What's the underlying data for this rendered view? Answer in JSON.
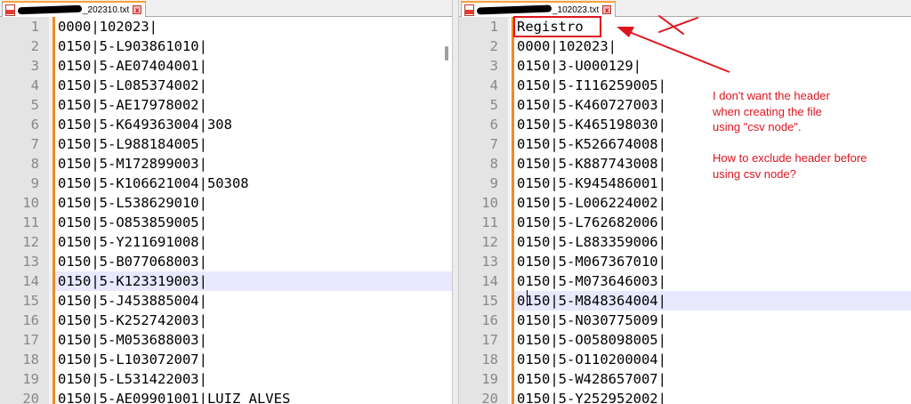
{
  "left_pane": {
    "tab": {
      "label": "_202310.txt",
      "close_glyph": "x"
    },
    "lines": [
      {
        "n": "1",
        "text": "0000|102023|"
      },
      {
        "n": "2",
        "text": "0150|5-L903861010|"
      },
      {
        "n": "3",
        "text": "0150|5-AE07404001|"
      },
      {
        "n": "4",
        "text": "0150|5-L085374002|"
      },
      {
        "n": "5",
        "text": "0150|5-AE17978002|"
      },
      {
        "n": "6",
        "text": "0150|5-K649363004|308"
      },
      {
        "n": "7",
        "text": "0150|5-L988184005|"
      },
      {
        "n": "8",
        "text": "0150|5-M172899003|"
      },
      {
        "n": "9",
        "text": "0150|5-K106621004|50308"
      },
      {
        "n": "10",
        "text": "0150|5-L538629010|"
      },
      {
        "n": "11",
        "text": "0150|5-O853859005|"
      },
      {
        "n": "12",
        "text": "0150|5-Y211691008|"
      },
      {
        "n": "13",
        "text": "0150|5-B077068003|"
      },
      {
        "n": "14",
        "text": "0150|5-K123319003|"
      },
      {
        "n": "15",
        "text": "0150|5-J453885004|"
      },
      {
        "n": "16",
        "text": "0150|5-K252742003|"
      },
      {
        "n": "17",
        "text": "0150|5-M053688003|"
      },
      {
        "n": "18",
        "text": "0150|5-L103072007|"
      },
      {
        "n": "19",
        "text": "0150|5-L531422003|"
      },
      {
        "n": "20",
        "text": "0150|5-AE09901001|LUIZ ALVES"
      }
    ]
  },
  "right_pane": {
    "tab": {
      "label": "_102023.txt",
      "close_glyph": "x"
    },
    "lines": [
      {
        "n": "1",
        "text": "Registro"
      },
      {
        "n": "2",
        "text": "0000|102023|"
      },
      {
        "n": "3",
        "text": "0150|3-U000129|"
      },
      {
        "n": "4",
        "text": "0150|5-I116259005|"
      },
      {
        "n": "5",
        "text": "0150|5-K460727003|"
      },
      {
        "n": "6",
        "text": "0150|5-K465198030|"
      },
      {
        "n": "7",
        "text": "0150|5-K526674008|"
      },
      {
        "n": "8",
        "text": "0150|5-K887743008|"
      },
      {
        "n": "9",
        "text": "0150|5-K945486001|"
      },
      {
        "n": "10",
        "text": "0150|5-L006224002|"
      },
      {
        "n": "11",
        "text": "0150|5-L762682006|"
      },
      {
        "n": "12",
        "text": "0150|5-L883359006|"
      },
      {
        "n": "13",
        "text": "0150|5-M067367010|"
      },
      {
        "n": "14",
        "text": "0150|5-M073646003|"
      },
      {
        "n": "15",
        "text": "0150|5-M848364004|"
      },
      {
        "n": "16",
        "text": "0150|5-N030775009|"
      },
      {
        "n": "17",
        "text": "0150|5-O058098005|"
      },
      {
        "n": "18",
        "text": "0150|5-O110200004|"
      },
      {
        "n": "19",
        "text": "0150|5-W428657007|"
      },
      {
        "n": "20",
        "text": "0150|5-Y252952002|"
      }
    ]
  },
  "annotation": {
    "text": "I don't want the header\nwhen creating the file\nusing \"csv node\".\n\nHow to exclude header before\nusing csv node?",
    "color": "#e0141e"
  },
  "colors": {
    "change_bar": "#f08a24",
    "current_line": "#e8e8ff",
    "gutter": "#e4e4e4",
    "tab_accent": "#f7a23a"
  },
  "icons": [
    "file-icon",
    "close-icon",
    "cross-mark-icon",
    "arrow-icon",
    "redaction-mark"
  ]
}
